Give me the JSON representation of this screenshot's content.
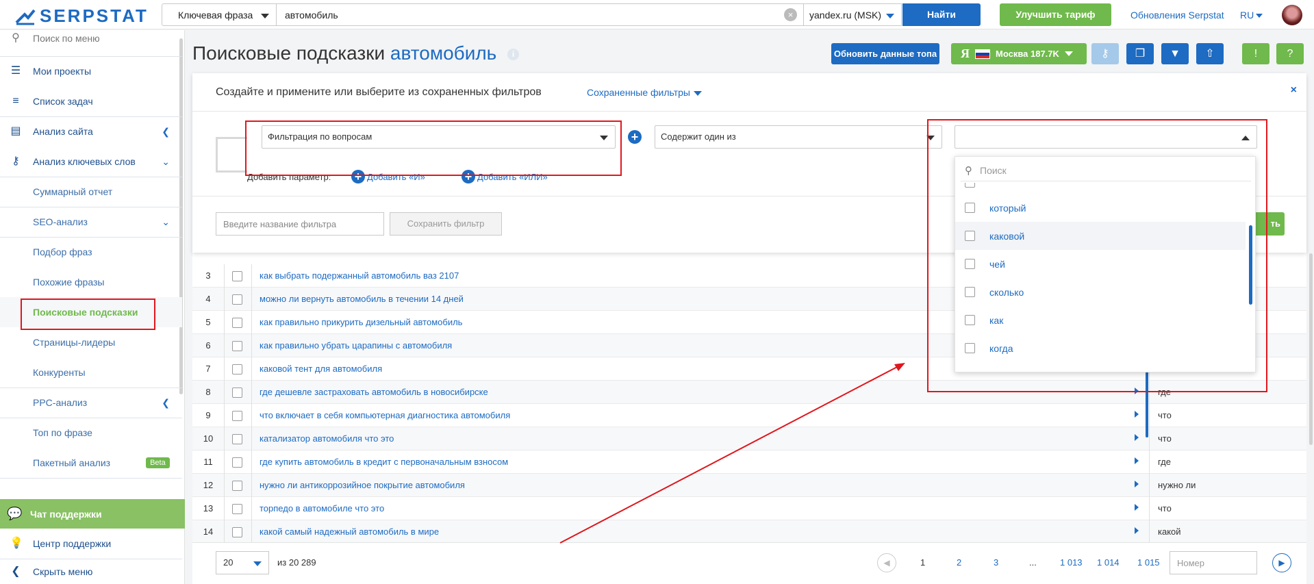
{
  "topbar": {
    "brand": "SERPSTAT",
    "search_type": "Ключевая фраза",
    "search_value": "автомобиль",
    "database": "yandex.ru (MSK)",
    "find_label": "Найти",
    "upgrade_label": "Улучшить тариф",
    "updates_label": "Обновления Serpstat",
    "lang": "RU"
  },
  "sidebar": {
    "search_placeholder": "Поиск по меню",
    "items": [
      {
        "label": "Мои проекты",
        "icon": "menu-icon"
      },
      {
        "label": "Список задач",
        "icon": "list-icon"
      },
      {
        "label": "Анализ сайта",
        "icon": "chart-icon"
      },
      {
        "label": "Анализ ключевых слов",
        "icon": "key-icon"
      }
    ],
    "keyword_sub": [
      "Суммарный отчет",
      "SEO-анализ"
    ],
    "seo_sub": [
      "Подбор фраз",
      "Похожие фразы",
      "Поисковые подсказки",
      "Страницы-лидеры",
      "Конкуренты"
    ],
    "ppc": "PPC-анализ",
    "ppc_sub": [
      "Топ по фразе",
      "Пакетный анализ"
    ],
    "beta": "Beta",
    "chat": "Чат поддержки",
    "help_center": "Центр поддержки",
    "hide_menu": "Скрыть меню"
  },
  "header": {
    "title": "Поисковые подсказки",
    "keyword": "автомобиль",
    "refresh_label": "Обновить данные топа",
    "region_label": "Москва 187.7K",
    "ya": "Я"
  },
  "filter": {
    "heading": "Создайте и примените или выберите из сохраненных фильтров",
    "saved_label": "Сохраненные фильтры",
    "param": "Фильтрация по вопросам",
    "condition": "Содержит один из",
    "value": "",
    "add_param": "Добавить параметр:",
    "add_and": "Добавить «И»",
    "add_or": "Добавить «ИЛИ»",
    "name_placeholder": "Введите название фильтра",
    "save_label": "Сохранить фильтр",
    "apply_label": "ть"
  },
  "dropdown": {
    "search_placeholder": "Поиск",
    "options": [
      "который",
      "каковой",
      "чей",
      "сколько",
      "как",
      "когда"
    ]
  },
  "table": {
    "rows": [
      {
        "n": "3",
        "phrase": "как выбрать подержанный автомобиль ваз 2107",
        "q": ""
      },
      {
        "n": "4",
        "phrase": "можно ли вернуть автомобиль в течении 14 дней",
        "q": ""
      },
      {
        "n": "5",
        "phrase": "как правильно прикурить дизельный автомобиль",
        "q": ""
      },
      {
        "n": "6",
        "phrase": "как правильно убрать царапины с автомобиля",
        "q": ""
      },
      {
        "n": "7",
        "phrase": "каковой тент для автомобиля",
        "q": ""
      },
      {
        "n": "8",
        "phrase": "где дешевле застраховать автомобиль в новосибирске",
        "q": "где"
      },
      {
        "n": "9",
        "phrase": "что включает в себя компьютерная диагностика автомобиля",
        "q": "что"
      },
      {
        "n": "10",
        "phrase": "катализатор автомобиля что это",
        "q": "что"
      },
      {
        "n": "11",
        "phrase": "где купить автомобиль в кредит с первоначальным взносом",
        "q": "где"
      },
      {
        "n": "12",
        "phrase": "нужно ли антикоррозийное покрытие автомобиля",
        "q": "нужно ли"
      },
      {
        "n": "13",
        "phrase": "торпедо в автомобиле что это",
        "q": "что"
      },
      {
        "n": "14",
        "phrase": "какой самый надежный автомобиль в мире",
        "q": "какой"
      }
    ]
  },
  "pager": {
    "per_page": "20",
    "of_total": "из 20 289",
    "pages": [
      "1",
      "2",
      "3",
      "...",
      "1 013",
      "1 014",
      "1 015"
    ],
    "page_input_placeholder": "Номер"
  },
  "colors": {
    "brand_blue": "#1d6bc2",
    "accent_green": "#70b94c",
    "annotation_red": "#e0161c"
  }
}
